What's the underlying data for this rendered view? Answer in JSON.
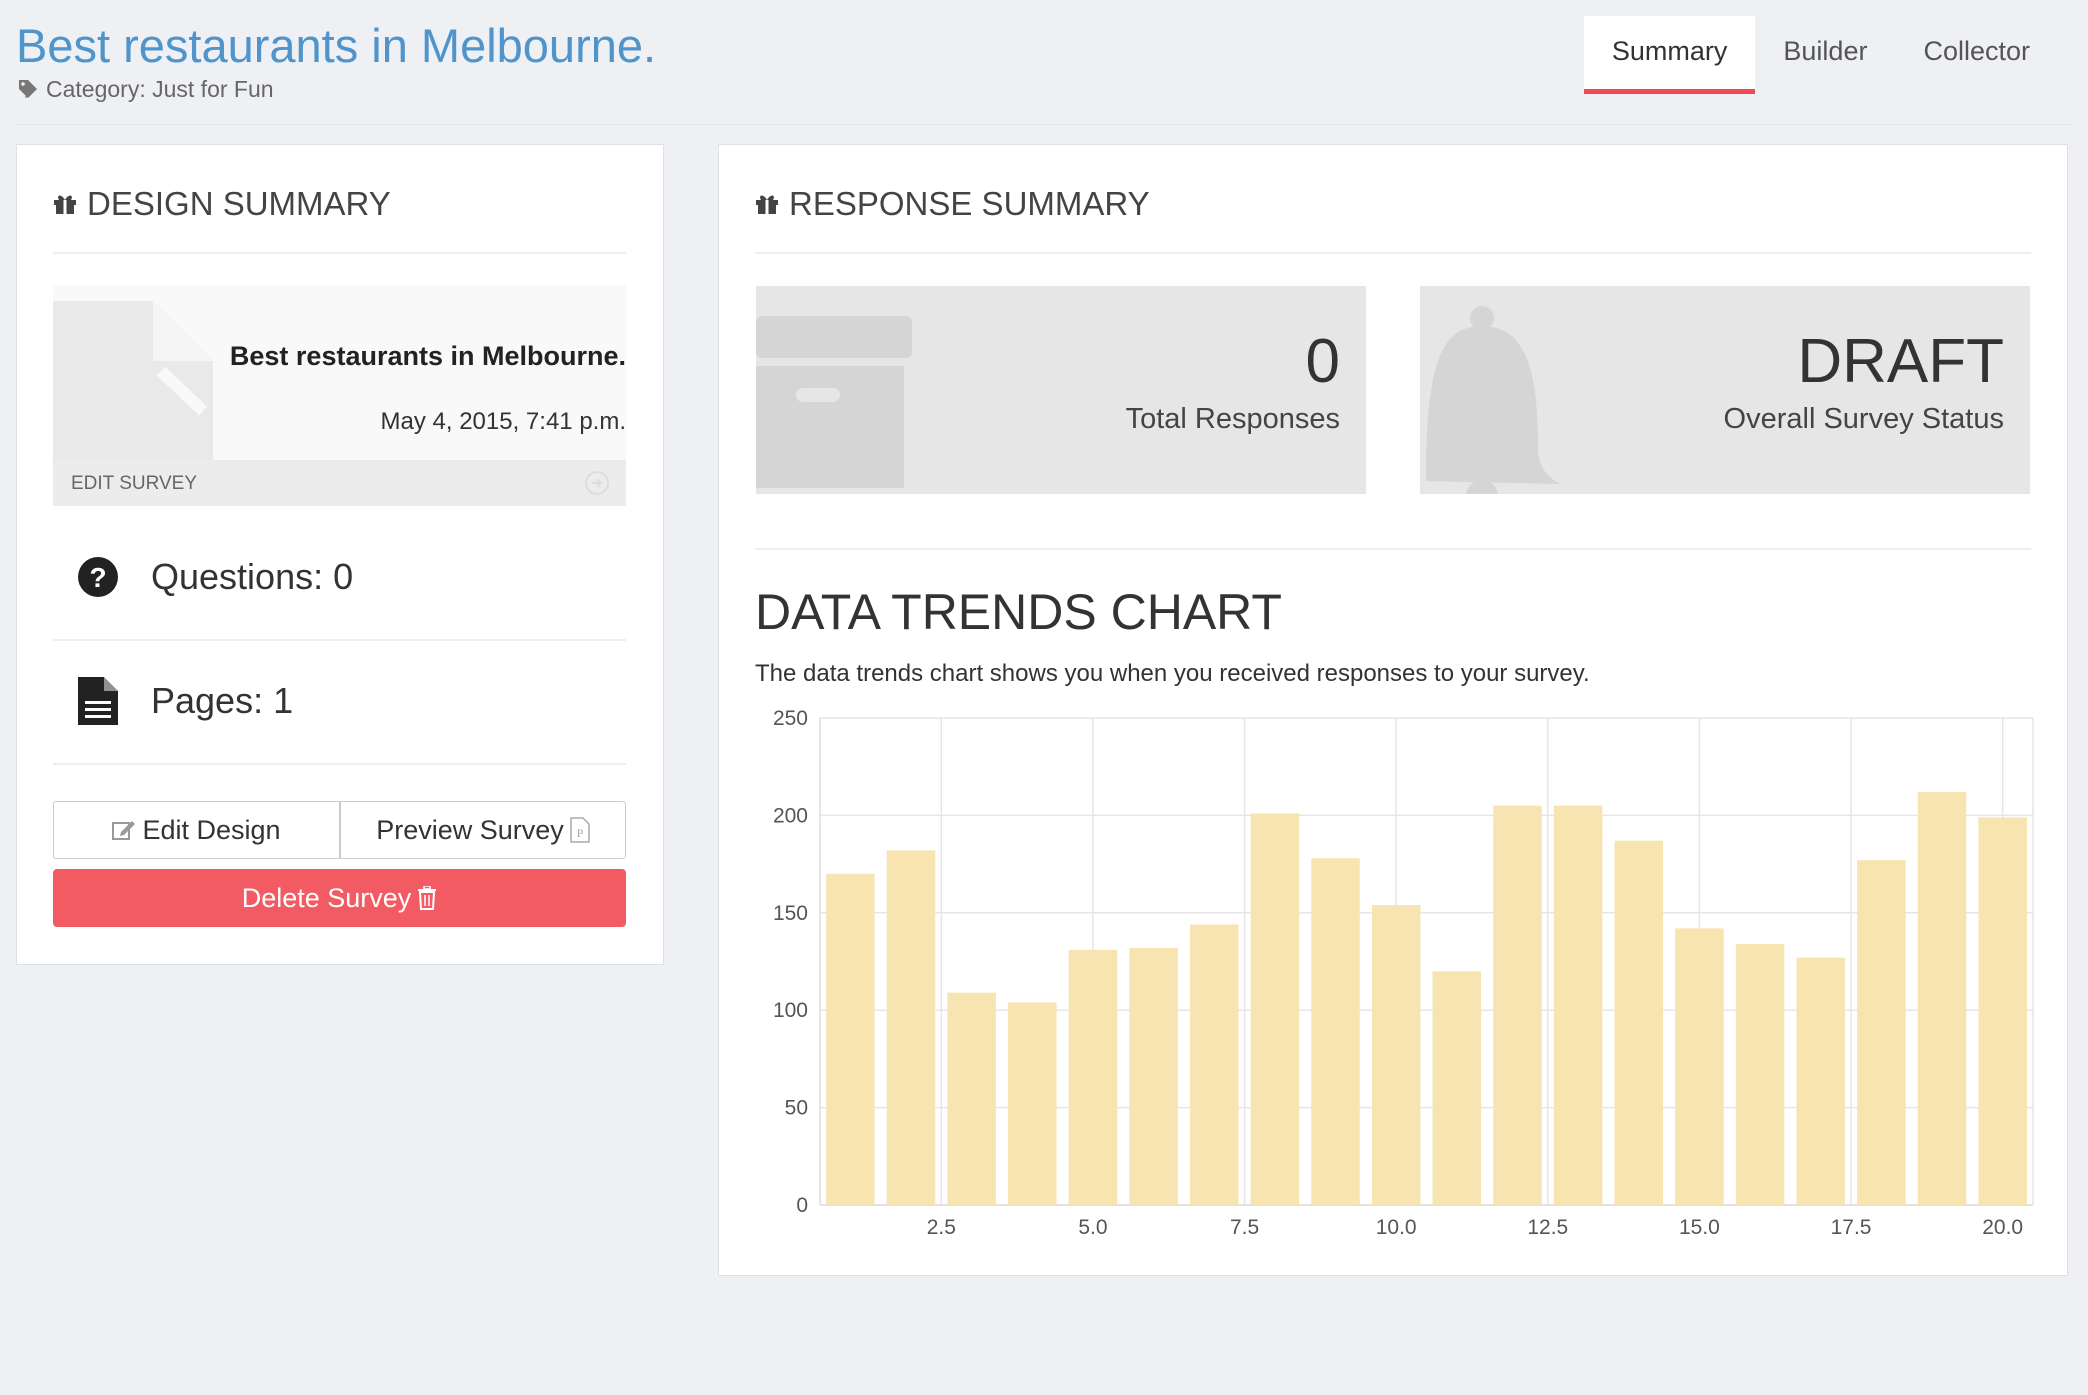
{
  "header": {
    "title": "Best restaurants in Melbourne.",
    "category": "Category: Just for Fun",
    "tabs": [
      {
        "label": "Summary",
        "active": true
      },
      {
        "label": "Builder",
        "active": false
      },
      {
        "label": "Collector",
        "active": false
      }
    ]
  },
  "design_summary": {
    "title": "DESIGN SUMMARY",
    "card": {
      "name": "Best restaurants in Melbourne.",
      "date": "May 4, 2015, 7:41 p.m.",
      "edit_label": "EDIT SURVEY"
    },
    "questions": "Questions: 0",
    "pages": "Pages: 1",
    "edit_design": "Edit Design",
    "preview_survey": "Preview Survey",
    "delete_survey": "Delete Survey"
  },
  "response_summary": {
    "title": "RESPONSE SUMMARY",
    "total_value": "0",
    "total_label": "Total Responses",
    "status_value": "DRAFT",
    "status_label": "Overall Survey Status"
  },
  "trends": {
    "title": "DATA TRENDS CHART",
    "description": "The data trends chart shows you when you received responses to your survey."
  },
  "colors": {
    "accent": "#ef4b53",
    "title_blue": "#4f95cb",
    "bar_fill": "#f8e4b0",
    "danger": "#f25b63"
  },
  "chart_data": {
    "type": "bar",
    "x": [
      1,
      2,
      3,
      4,
      5,
      6,
      7,
      8,
      9,
      10,
      11,
      12,
      13,
      14,
      15,
      16,
      17,
      18,
      19,
      20
    ],
    "values": [
      170,
      182,
      109,
      104,
      131,
      132,
      144,
      201,
      178,
      154,
      120,
      205,
      205,
      187,
      142,
      134,
      127,
      177,
      212,
      199
    ],
    "ylim": [
      0,
      250
    ],
    "yticks": [
      0,
      50,
      100,
      150,
      200,
      250
    ],
    "xticks": [
      "2.5",
      "5.0",
      "7.5",
      "10.0",
      "12.5",
      "15.0",
      "17.5",
      "20.0"
    ],
    "xtick_values": [
      2.5,
      5.0,
      7.5,
      10.0,
      12.5,
      15.0,
      17.5,
      20.0
    ],
    "grid": true
  }
}
